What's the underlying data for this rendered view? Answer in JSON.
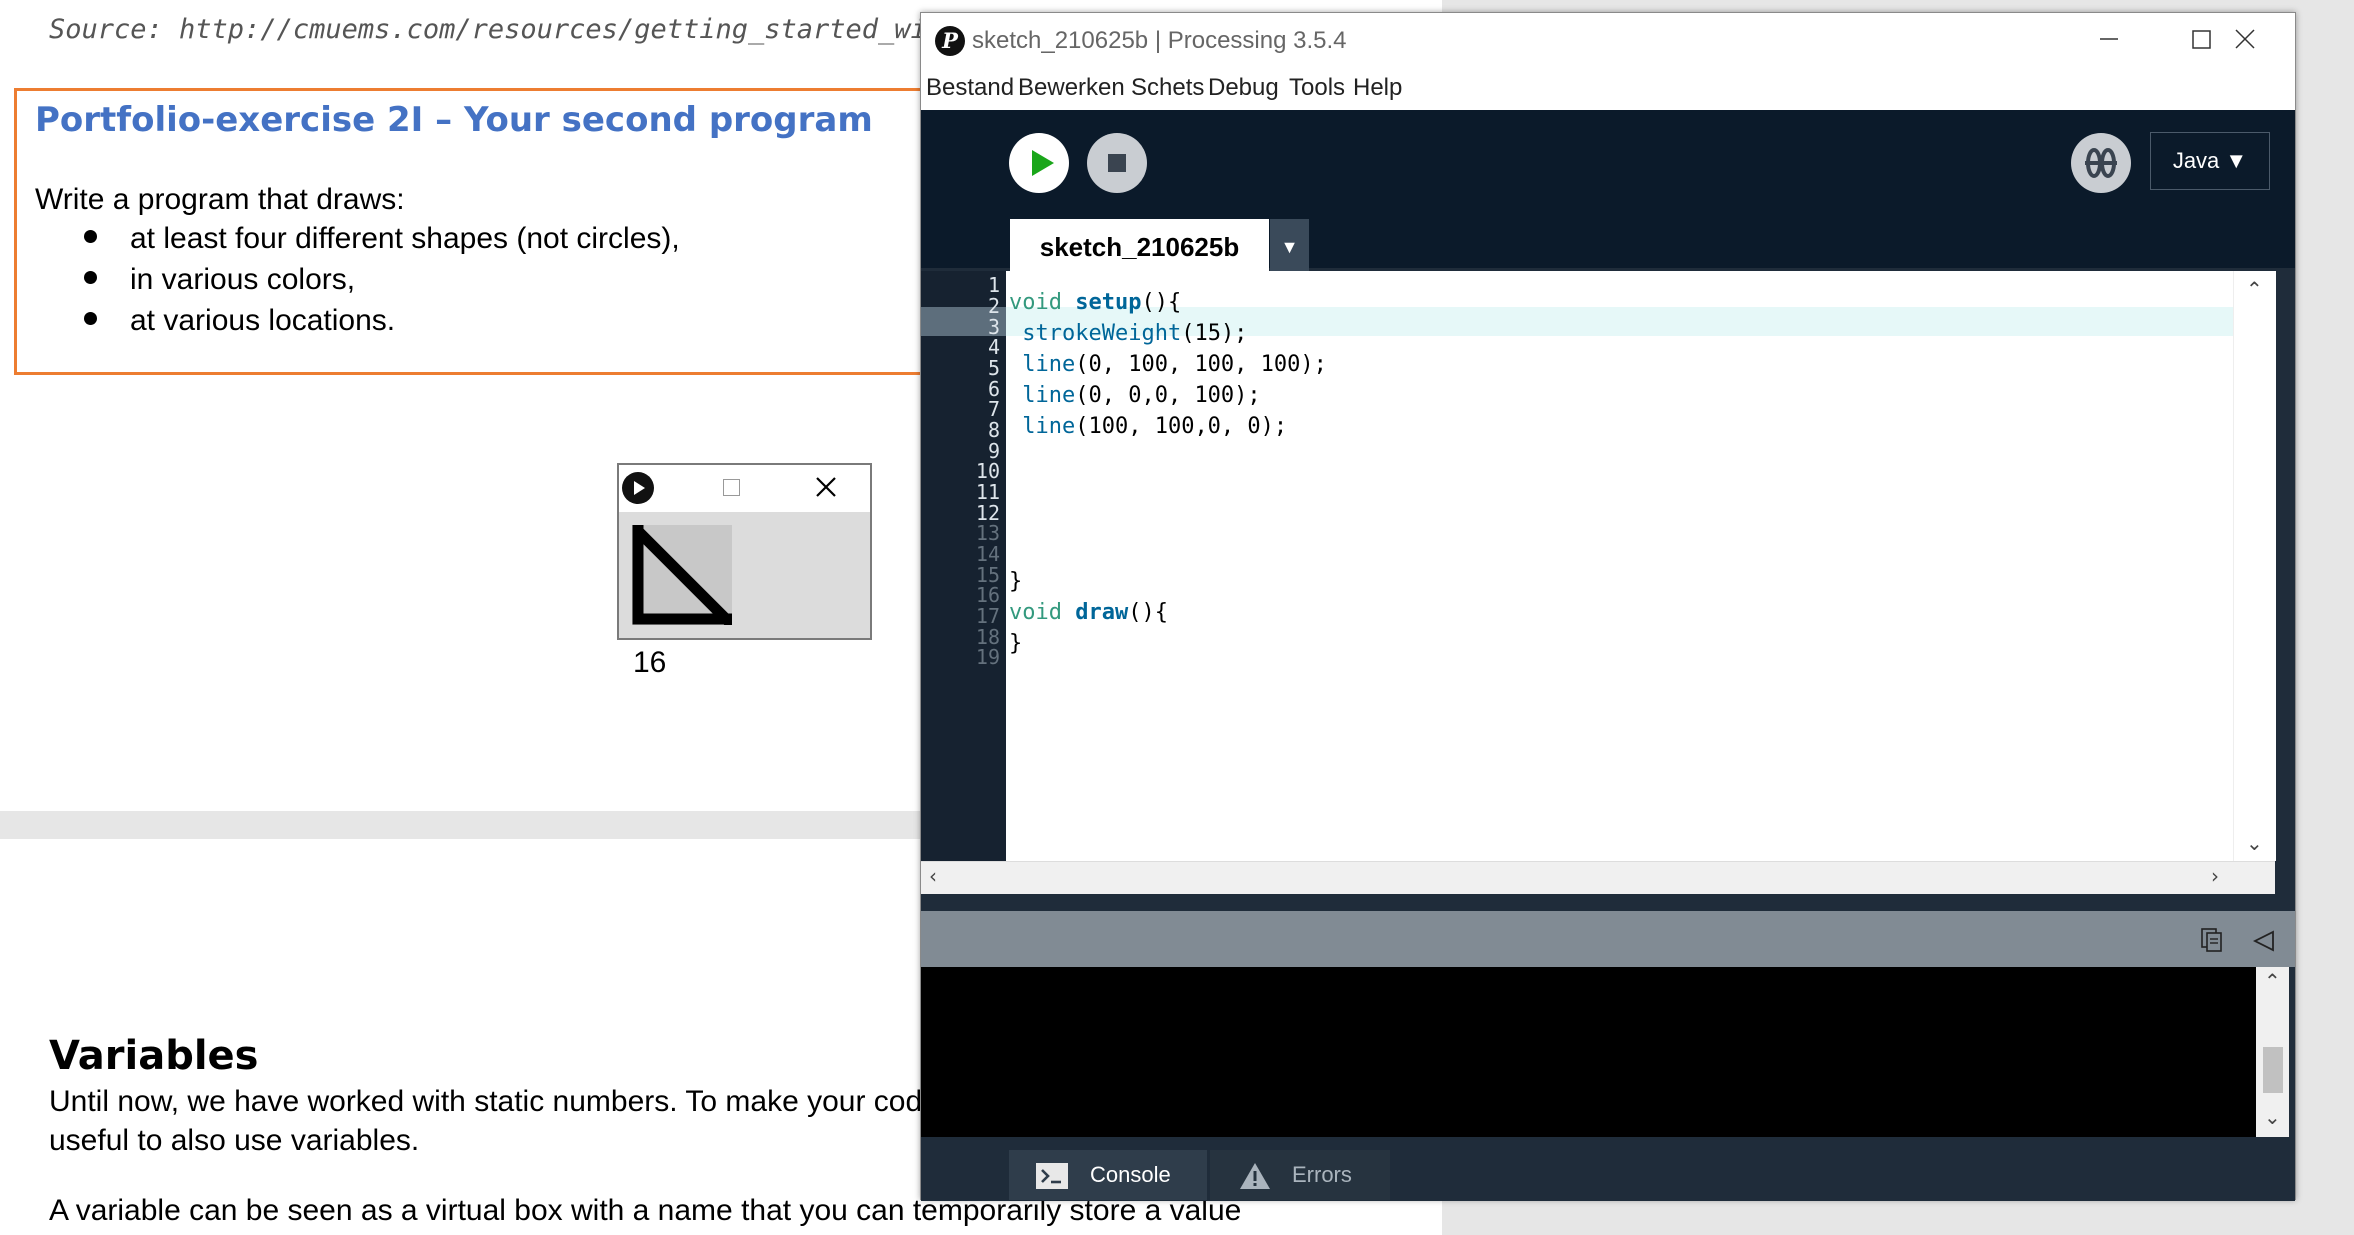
{
  "document": {
    "source_line": "Source: http://cmuems.com/resources/getting_started_with_pr",
    "exercise": {
      "title": "Portfolio-exercise 2I – Your second program",
      "intro": "Write a program that draws:",
      "bullets": [
        "at least four different shapes (not circles),",
        "in various colors,",
        "at various locations."
      ]
    },
    "page_number": "16",
    "variables": {
      "heading": "Variables",
      "paragraph1": "Until now, we have worked with static numbers. To make your code useful to also use variables.",
      "paragraph2": "A variable can be seen as a virtual box with a name that you can temporarily store a value"
    }
  },
  "sketch_window": {
    "canvas_icon": "triangle-drawing"
  },
  "processing": {
    "window_title": "sketch_210625b | Processing 3.5.4",
    "menu": [
      "Bestand",
      "Bewerken",
      "Schets",
      "Debug",
      "Tools",
      "Help"
    ],
    "mode": "Java ▼",
    "tab_name": "sketch_210625b",
    "tab_menu_glyph": "▼",
    "line_numbers": [
      "1",
      "2",
      "3",
      "4",
      "5",
      "6",
      "7",
      "8",
      "9",
      "10",
      "11",
      "12",
      "13",
      "14",
      "15",
      "16",
      "17",
      "18",
      "19"
    ],
    "code": {
      "l1_kw": "void",
      "l1_fn": "setup",
      "l1_rest": "(){",
      "l2_call": "strokeWeight",
      "l2_rest": "(15);",
      "l3_call": "line",
      "l3_rest": "(0, 100, 100, 100);",
      "l4_call": "line",
      "l4_rest": "(0, 0,0, 100);",
      "l5_call": "line",
      "l5_rest": "(100, 100,0, 0);",
      "l10": "}",
      "l11_kw": "void",
      "l11_fn": "draw",
      "l11_rest": "(){",
      "l12": "}"
    },
    "footer_tabs": {
      "console": "Console",
      "errors": "Errors"
    },
    "colors": {
      "toolbar_bg": "#0b1a2a",
      "run_green": "#1aa61a",
      "keyword": "#33997e",
      "function": "#006699"
    }
  }
}
